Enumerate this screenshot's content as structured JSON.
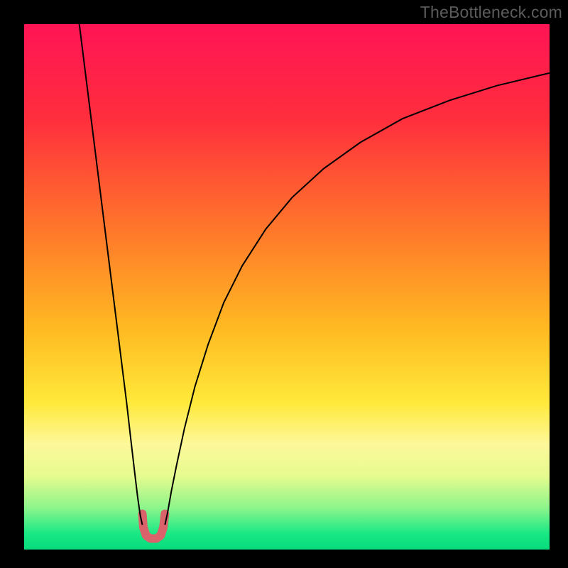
{
  "watermark": "TheBottleneck.com",
  "chart_data": {
    "type": "line",
    "title": "",
    "xlabel": "",
    "ylabel": "",
    "xlim": [
      0,
      100
    ],
    "ylim": [
      0,
      100
    ],
    "gradient_stops": [
      {
        "offset": 0,
        "color": "#ff1455"
      },
      {
        "offset": 18,
        "color": "#ff2e3d"
      },
      {
        "offset": 40,
        "color": "#ff7a2a"
      },
      {
        "offset": 58,
        "color": "#ffba22"
      },
      {
        "offset": 72,
        "color": "#ffe93a"
      },
      {
        "offset": 80,
        "color": "#fdf89a"
      },
      {
        "offset": 86,
        "color": "#e6fb8f"
      },
      {
        "offset": 92,
        "color": "#8ef58b"
      },
      {
        "offset": 97,
        "color": "#18e884"
      },
      {
        "offset": 100,
        "color": "#07db7d"
      }
    ],
    "series": [
      {
        "name": "left-branch",
        "stroke": "#000000",
        "stroke_width": 2,
        "points": [
          {
            "x": 10.5,
            "y": 100
          },
          {
            "x": 11.5,
            "y": 92
          },
          {
            "x": 12.5,
            "y": 84
          },
          {
            "x": 13.5,
            "y": 76
          },
          {
            "x": 14.5,
            "y": 68
          },
          {
            "x": 15.5,
            "y": 60
          },
          {
            "x": 16.5,
            "y": 52
          },
          {
            "x": 17.5,
            "y": 44
          },
          {
            "x": 18.5,
            "y": 36
          },
          {
            "x": 19.5,
            "y": 28
          },
          {
            "x": 20.3,
            "y": 21
          },
          {
            "x": 21.0,
            "y": 15
          },
          {
            "x": 21.6,
            "y": 10
          },
          {
            "x": 22.1,
            "y": 6.5
          },
          {
            "x": 22.5,
            "y": 4.7
          }
        ]
      },
      {
        "name": "right-branch",
        "stroke": "#000000",
        "stroke_width": 2,
        "points": [
          {
            "x": 26.8,
            "y": 4.7
          },
          {
            "x": 27.3,
            "y": 7
          },
          {
            "x": 28.0,
            "y": 11
          },
          {
            "x": 29.0,
            "y": 16
          },
          {
            "x": 30.5,
            "y": 23
          },
          {
            "x": 32.5,
            "y": 31
          },
          {
            "x": 35.0,
            "y": 39
          },
          {
            "x": 38.0,
            "y": 47
          },
          {
            "x": 41.5,
            "y": 54
          },
          {
            "x": 46.0,
            "y": 61
          },
          {
            "x": 51.0,
            "y": 67
          },
          {
            "x": 57.0,
            "y": 72.5
          },
          {
            "x": 64.0,
            "y": 77.5
          },
          {
            "x": 72.0,
            "y": 82
          },
          {
            "x": 81.0,
            "y": 85.5
          },
          {
            "x": 90.0,
            "y": 88.3
          },
          {
            "x": 100.0,
            "y": 90.7
          }
        ]
      },
      {
        "name": "valley-marker",
        "stroke": "#d9626b",
        "stroke_width": 12,
        "linecap": "round",
        "points": [
          {
            "x": 22.5,
            "y": 6.8
          },
          {
            "x": 22.7,
            "y": 4.2
          },
          {
            "x": 23.2,
            "y": 2.7
          },
          {
            "x": 24.0,
            "y": 2.1
          },
          {
            "x": 25.2,
            "y": 2.1
          },
          {
            "x": 26.0,
            "y": 2.7
          },
          {
            "x": 26.5,
            "y": 4.2
          },
          {
            "x": 26.8,
            "y": 6.8
          }
        ]
      }
    ]
  }
}
